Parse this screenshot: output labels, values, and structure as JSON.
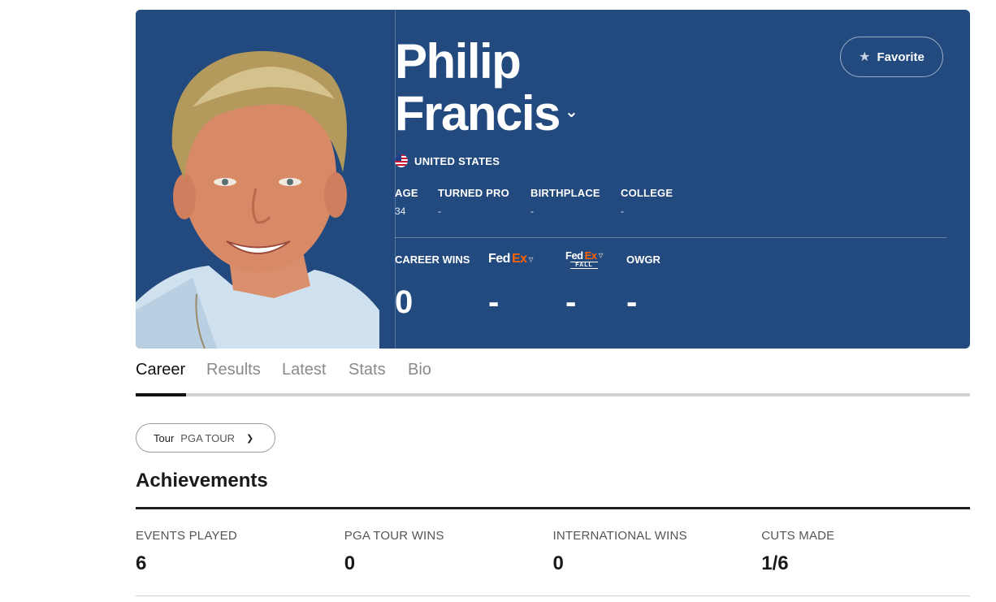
{
  "player": {
    "first_name": "Philip",
    "last_name": "Francis",
    "country": "UNITED STATES",
    "favorite_label": "Favorite"
  },
  "bio_stats": [
    {
      "label": "AGE",
      "value": "34"
    },
    {
      "label": "TURNED PRO",
      "value": "-"
    },
    {
      "label": "BIRTHPLACE",
      "value": "-"
    },
    {
      "label": "COLLEGE",
      "value": "-"
    }
  ],
  "career": {
    "wins_label": "CAREER WINS",
    "wins_value": "0",
    "fedex_logo": {
      "fe": "Fed",
      "ex": "Ex"
    },
    "fedex_value": "-",
    "fedex_fall_logo": {
      "fe": "Fed",
      "ex": "Ex",
      "sub": "FALL"
    },
    "fedex_fall_value": "-",
    "owgr_label": "OWGR",
    "owgr_value": "-"
  },
  "tabs": [
    "Career",
    "Results",
    "Latest",
    "Stats",
    "Bio"
  ],
  "active_tab": "Career",
  "tour_select": {
    "label": "Tour",
    "value": "PGA TOUR"
  },
  "achievements": {
    "title": "Achievements",
    "items": [
      {
        "label": "EVENTS PLAYED",
        "value": "6"
      },
      {
        "label": "PGA TOUR WINS",
        "value": "0"
      },
      {
        "label": "INTERNATIONAL WINS",
        "value": "0"
      },
      {
        "label": "CUTS MADE",
        "value": "1/6"
      }
    ]
  },
  "colors": {
    "hero_bg": "#224a7e",
    "fedex_orange": "#ff6200"
  },
  "icons": [
    "star-icon",
    "chevron-down-icon",
    "us-flag-icon",
    "trophy-icon"
  ]
}
